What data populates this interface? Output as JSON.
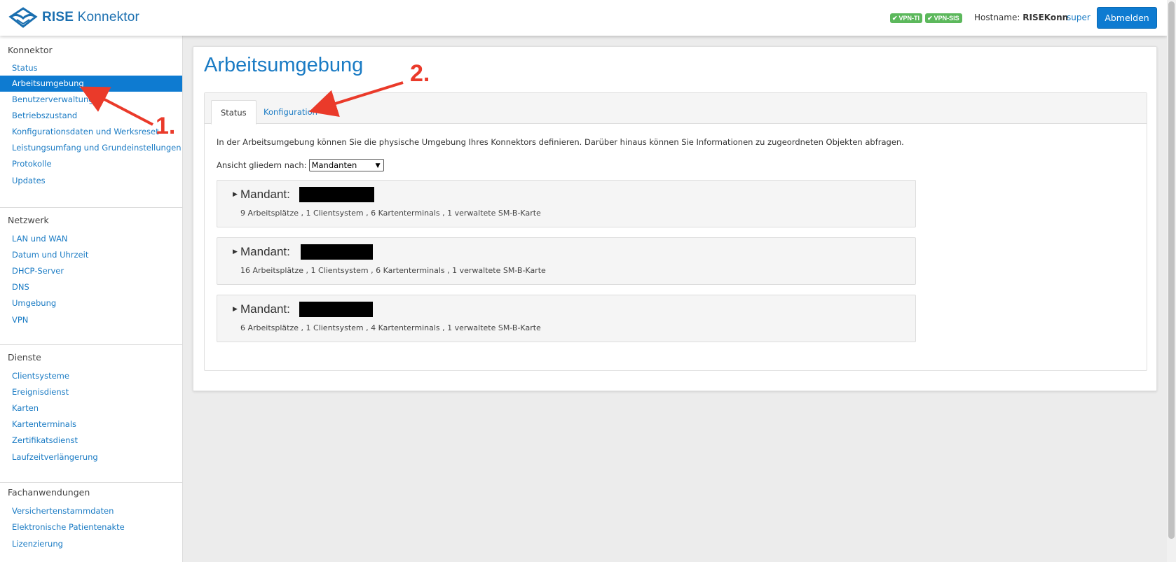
{
  "header": {
    "logo_brand": "RISE",
    "logo_product": "Konnektor",
    "badges": [
      "VPN-TI",
      "VPN-SIS"
    ],
    "hostname_label": "Hostname:",
    "hostname_value": "RISEKonn",
    "user": "super",
    "logout_label": "Abmelden"
  },
  "sidebar": {
    "sections": [
      {
        "heading": "Konnektor",
        "items": [
          {
            "label": "Status"
          },
          {
            "label": "Arbeitsumgebung",
            "active": true
          },
          {
            "label": "Benutzerverwaltung"
          },
          {
            "label": "Betriebszustand"
          },
          {
            "label": "Konfigurationsdaten und Werksreset"
          },
          {
            "label": "Leistungsumfang und Grundeinstellungen"
          },
          {
            "label": "Protokolle"
          },
          {
            "label": "Updates"
          }
        ]
      },
      {
        "heading": "Netzwerk",
        "items": [
          {
            "label": "LAN und WAN"
          },
          {
            "label": "Datum und Uhrzeit"
          },
          {
            "label": "DHCP-Server"
          },
          {
            "label": "DNS"
          },
          {
            "label": "Umgebung"
          },
          {
            "label": "VPN"
          }
        ]
      },
      {
        "heading": "Dienste",
        "items": [
          {
            "label": "Clientsysteme"
          },
          {
            "label": "Ereignisdienst"
          },
          {
            "label": "Karten"
          },
          {
            "label": "Kartenterminals"
          },
          {
            "label": "Zertifikatsdienst"
          },
          {
            "label": "Laufzeitverlängerung"
          }
        ]
      },
      {
        "heading": "Fachanwendungen",
        "items": [
          {
            "label": "Versichertenstammdaten"
          },
          {
            "label": "Elektronische Patientenakte"
          },
          {
            "label": "Lizenzierung"
          }
        ]
      }
    ]
  },
  "main": {
    "title": "Arbeitsumgebung",
    "tabs": [
      {
        "label": "Status",
        "active": true
      },
      {
        "label": "Konfiguration",
        "active": false
      }
    ],
    "intro": "In der Arbeitsumgebung können Sie die physische Umgebung Ihres Konnektors definieren. Darüber hinaus können Sie Informationen zu zugeordneten Objekten abfragen.",
    "group_by_label": "Ansicht gliedern nach:",
    "group_by_value": "Mandanten",
    "mandanten": [
      {
        "label": "Mandant:",
        "summary": "9 Arbeitsplätze , 1 Clientsystem , 6 Kartenterminals , 1 verwaltete SM-B-Karte"
      },
      {
        "label": "Mandant:",
        "summary": "16 Arbeitsplätze , 1 Clientsystem , 6 Kartenterminals , 1 verwaltete SM-B-Karte"
      },
      {
        "label": "Mandant:",
        "summary": "6 Arbeitsplätze , 1 Clientsystem , 4 Kartenterminals , 1 verwaltete SM-B-Karte"
      }
    ]
  },
  "annotations": [
    "1.",
    "2."
  ],
  "colors": {
    "accent": "#0e7bd1",
    "link": "#1a7bc4",
    "badge": "#5cb85c",
    "annotation": "#ea3a2a"
  }
}
